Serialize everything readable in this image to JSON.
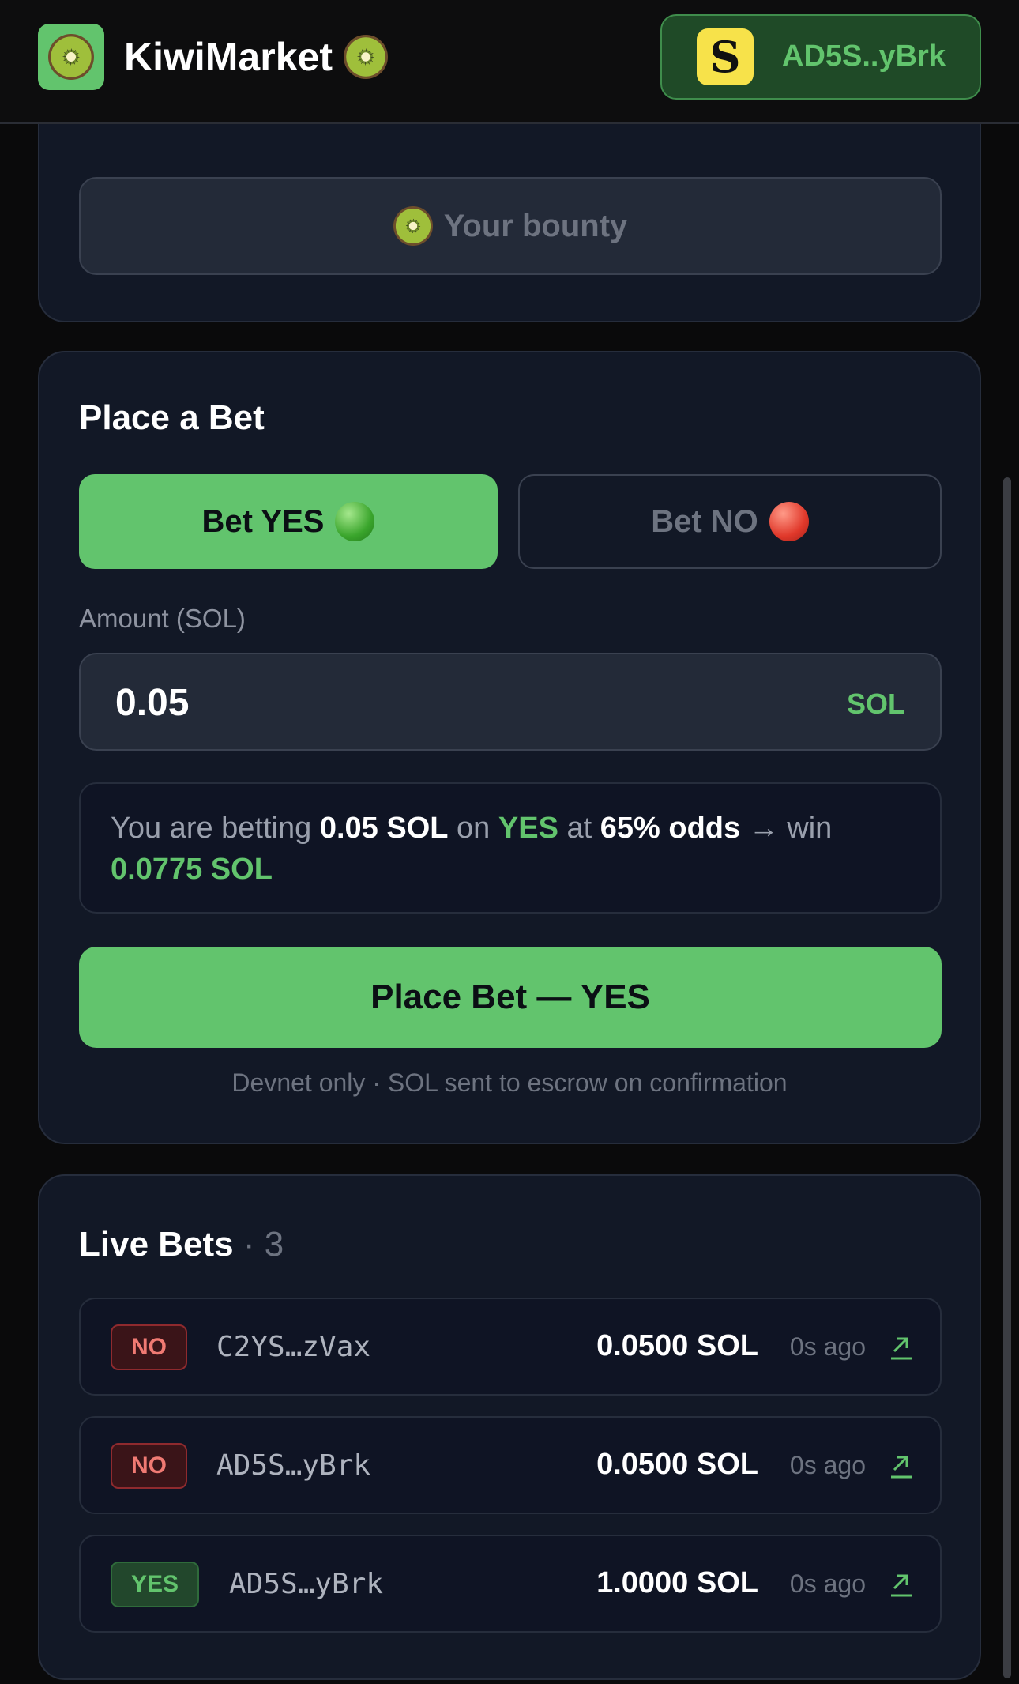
{
  "header": {
    "app_name": "KiwiMarket",
    "logo_icon": "kiwi-icon",
    "wallet_address": "AD5S..yBrk",
    "wallet_icon": "s-token-icon"
  },
  "bounty": {
    "label": "Your bounty",
    "icon": "kiwi-icon"
  },
  "place_bet": {
    "title": "Place a Bet",
    "yes_label": "Bet YES",
    "no_label": "Bet NO",
    "amount_label": "Amount (SOL)",
    "amount_value": "0.05",
    "amount_unit": "SOL",
    "summary": {
      "prefix": "You are betting",
      "amount": "0.05 SOL",
      "on": "on",
      "side": "YES",
      "at": "at",
      "odds": "65% odds",
      "arrow": "→ win",
      "payout": "0.0775 SOL"
    },
    "submit_label": "Place Bet — YES",
    "footnote": "Devnet only · SOL sent to escrow on confirmation"
  },
  "live_bets": {
    "title": "Live Bets",
    "count": "· 3",
    "rows": [
      {
        "side": "NO",
        "address": "C2YS…zVax",
        "amount": "0.0500 SOL",
        "time": "0s ago"
      },
      {
        "side": "NO",
        "address": "AD5S…yBrk",
        "amount": "0.0500 SOL",
        "time": "0s ago"
      },
      {
        "side": "YES",
        "address": "AD5S…yBrk",
        "amount": "1.0000 SOL",
        "time": "0s ago"
      }
    ]
  },
  "colors": {
    "accent": "#62c46d",
    "background": "#0a0a0b",
    "card": "#121826",
    "no_badge": "#f07a73"
  }
}
